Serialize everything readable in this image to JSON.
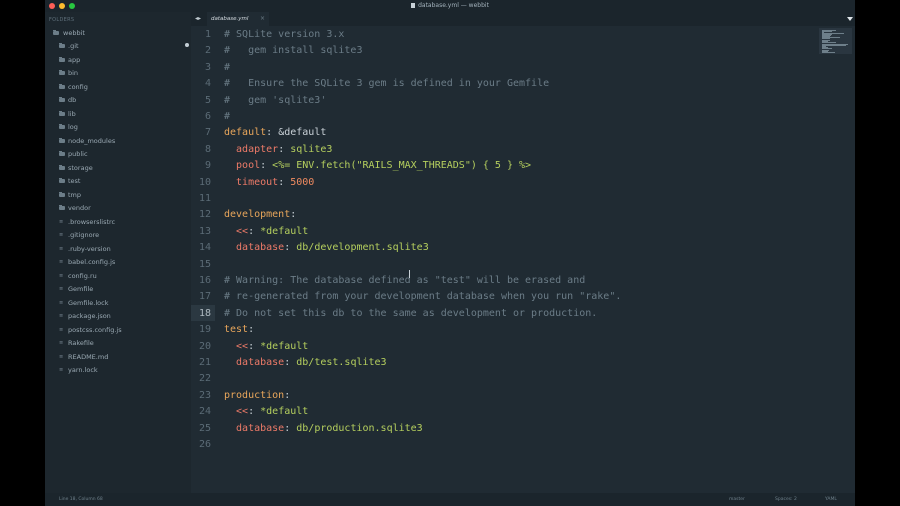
{
  "window": {
    "title": "database.yml — webbit"
  },
  "sidebar": {
    "header": "FOLDERS",
    "root": "webbit",
    "items": [
      {
        "label": ".git",
        "kind": "folder"
      },
      {
        "label": "app",
        "kind": "folder"
      },
      {
        "label": "bin",
        "kind": "folder"
      },
      {
        "label": "config",
        "kind": "folder"
      },
      {
        "label": "db",
        "kind": "folder"
      },
      {
        "label": "lib",
        "kind": "folder"
      },
      {
        "label": "log",
        "kind": "folder"
      },
      {
        "label": "node_modules",
        "kind": "folder"
      },
      {
        "label": "public",
        "kind": "folder"
      },
      {
        "label": "storage",
        "kind": "folder"
      },
      {
        "label": "test",
        "kind": "folder"
      },
      {
        "label": "tmp",
        "kind": "folder"
      },
      {
        "label": "vendor",
        "kind": "folder"
      },
      {
        "label": ".browserslistrc",
        "kind": "file"
      },
      {
        "label": ".gitignore",
        "kind": "file"
      },
      {
        "label": ".ruby-version",
        "kind": "file"
      },
      {
        "label": "babel.config.js",
        "kind": "file"
      },
      {
        "label": "config.ru",
        "kind": "file"
      },
      {
        "label": "Gemfile",
        "kind": "file"
      },
      {
        "label": "Gemfile.lock",
        "kind": "file"
      },
      {
        "label": "package.json",
        "kind": "file"
      },
      {
        "label": "postcss.config.js",
        "kind": "file"
      },
      {
        "label": "Rakefile",
        "kind": "file"
      },
      {
        "label": "README.md",
        "kind": "file"
      },
      {
        "label": "yarn.lock",
        "kind": "file"
      }
    ]
  },
  "tabs": [
    {
      "label": "database.yml",
      "active": true
    }
  ],
  "editor": {
    "current_line": 18,
    "lines": [
      {
        "n": "1",
        "parts": [
          {
            "t": "# SQLite version 3.x",
            "c": "comment"
          }
        ]
      },
      {
        "n": "2",
        "parts": [
          {
            "t": "#   gem install sqlite3",
            "c": "comment"
          }
        ]
      },
      {
        "n": "3",
        "parts": [
          {
            "t": "#",
            "c": "comment"
          }
        ]
      },
      {
        "n": "4",
        "parts": [
          {
            "t": "#   Ensure the SQLite 3 gem is defined in your Gemfile",
            "c": "comment"
          }
        ]
      },
      {
        "n": "5",
        "parts": [
          {
            "t": "#   gem 'sqlite3'",
            "c": "comment"
          }
        ]
      },
      {
        "n": "6",
        "parts": [
          {
            "t": "#",
            "c": "comment"
          }
        ]
      },
      {
        "n": "7",
        "parts": [
          {
            "t": "default",
            "c": "key"
          },
          {
            "t": ": ",
            "c": "plain"
          },
          {
            "t": "&default",
            "c": "plain"
          }
        ]
      },
      {
        "n": "8",
        "parts": [
          {
            "t": "  adapter",
            "c": "sub"
          },
          {
            "t": ": ",
            "c": "plain"
          },
          {
            "t": "sqlite3",
            "c": "str"
          }
        ]
      },
      {
        "n": "9",
        "parts": [
          {
            "t": "  pool",
            "c": "sub"
          },
          {
            "t": ": ",
            "c": "plain"
          },
          {
            "t": "<%= ENV.fetch(\"RAILS_MAX_THREADS\") { 5 } %>",
            "c": "str"
          }
        ]
      },
      {
        "n": "10",
        "parts": [
          {
            "t": "  timeout",
            "c": "sub"
          },
          {
            "t": ": ",
            "c": "plain"
          },
          {
            "t": "5000",
            "c": "num"
          }
        ]
      },
      {
        "n": "11",
        "parts": []
      },
      {
        "n": "12",
        "parts": [
          {
            "t": "development",
            "c": "key"
          },
          {
            "t": ":",
            "c": "plain"
          }
        ]
      },
      {
        "n": "13",
        "parts": [
          {
            "t": "  <<",
            "c": "sub"
          },
          {
            "t": ": ",
            "c": "plain"
          },
          {
            "t": "*default",
            "c": "str"
          }
        ]
      },
      {
        "n": "14",
        "parts": [
          {
            "t": "  database",
            "c": "sub"
          },
          {
            "t": ": ",
            "c": "plain"
          },
          {
            "t": "db/development.sqlite3",
            "c": "str"
          }
        ]
      },
      {
        "n": "15",
        "parts": []
      },
      {
        "n": "16",
        "parts": [
          {
            "t": "# Warning: The database defined as \"test\" will be erased and",
            "c": "comment"
          }
        ]
      },
      {
        "n": "17",
        "parts": [
          {
            "t": "# re-generated from your development database when you run \"rake\".",
            "c": "comment"
          }
        ]
      },
      {
        "n": "18",
        "parts": [
          {
            "t": "# Do not set this db to the same as development or production.",
            "c": "comment"
          }
        ]
      },
      {
        "n": "19",
        "parts": [
          {
            "t": "test",
            "c": "key"
          },
          {
            "t": ":",
            "c": "plain"
          }
        ]
      },
      {
        "n": "20",
        "parts": [
          {
            "t": "  <<",
            "c": "sub"
          },
          {
            "t": ": ",
            "c": "plain"
          },
          {
            "t": "*default",
            "c": "str"
          }
        ]
      },
      {
        "n": "21",
        "parts": [
          {
            "t": "  database",
            "c": "sub"
          },
          {
            "t": ": ",
            "c": "plain"
          },
          {
            "t": "db/test.sqlite3",
            "c": "str"
          }
        ]
      },
      {
        "n": "22",
        "parts": []
      },
      {
        "n": "23",
        "parts": [
          {
            "t": "production",
            "c": "key"
          },
          {
            "t": ":",
            "c": "plain"
          }
        ]
      },
      {
        "n": "24",
        "parts": [
          {
            "t": "  <<",
            "c": "sub"
          },
          {
            "t": ": ",
            "c": "plain"
          },
          {
            "t": "*default",
            "c": "str"
          }
        ]
      },
      {
        "n": "25",
        "parts": [
          {
            "t": "  database",
            "c": "sub"
          },
          {
            "t": ": ",
            "c": "plain"
          },
          {
            "t": "db/production.sqlite3",
            "c": "str"
          }
        ]
      },
      {
        "n": "26",
        "parts": []
      }
    ]
  },
  "statusbar": {
    "position": "Line 18, Column 68",
    "branch": "master",
    "spaces": "Spaces: 2",
    "syntax": "YAML"
  },
  "colors": {
    "background": "#202b33",
    "sidebar": "#1d272e",
    "comment": "#6b7c87",
    "key": "#e8a65b",
    "string": "#b5cf5e",
    "number": "#f08b60"
  }
}
